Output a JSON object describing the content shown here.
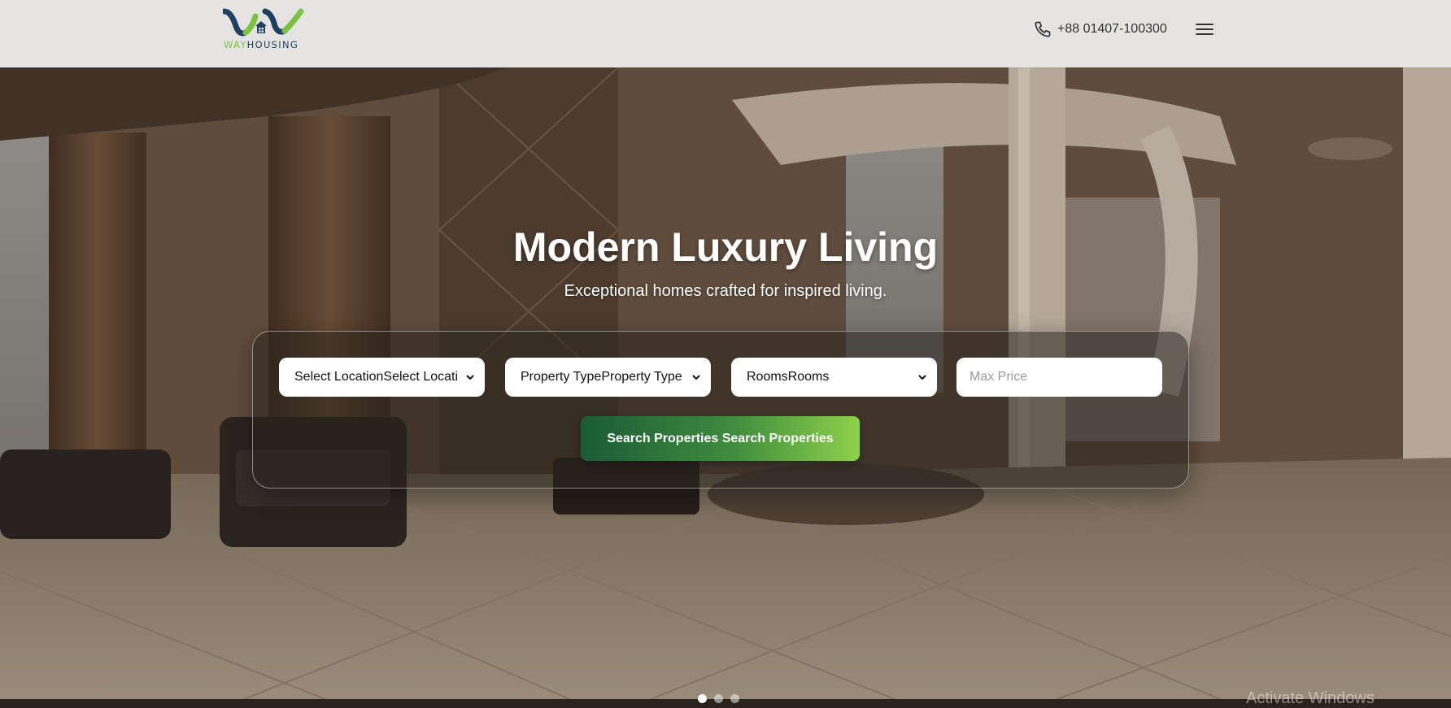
{
  "brand": {
    "logo_part1": "WAY",
    "logo_part2": "HOUSING",
    "logo_color_green": "#7cc242",
    "logo_color_navy": "#1f3f63"
  },
  "header": {
    "phone_icon": "phone-icon",
    "phone_number": "+88 01407-100300",
    "menu_icon": "hamburger-menu-icon"
  },
  "hero": {
    "title": "Modern Luxury Living",
    "subtitle": "Exceptional homes crafted for inspired living."
  },
  "search": {
    "location_value": "Select LocationSelect Locati",
    "property_type_value": "Property TypeProperty Type",
    "rooms_value": "RoomsRooms",
    "max_price_placeholder": "Max Price",
    "button_label": "Search Properties Search Properties",
    "button_gradient": [
      "#1b5a36",
      "#8fd14b"
    ]
  },
  "carousel": {
    "slide_count": 3,
    "active_index": 0
  },
  "os_watermark": "Activate Windows"
}
